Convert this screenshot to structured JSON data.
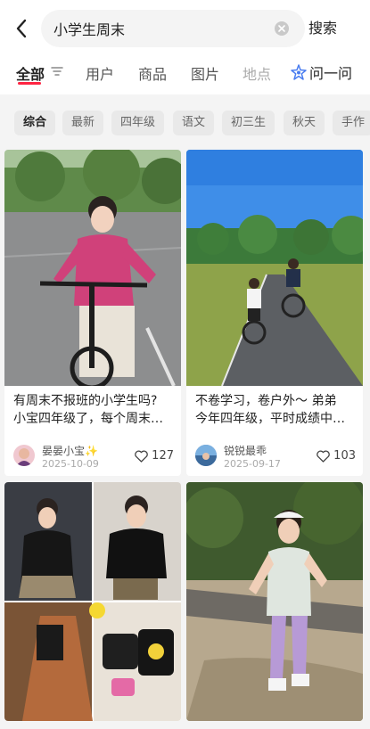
{
  "search": {
    "query": "小学生周末",
    "button_label": "搜索"
  },
  "tabs": [
    {
      "label": "全部"
    },
    {
      "label": "用户"
    },
    {
      "label": "商品"
    },
    {
      "label": "图片"
    },
    {
      "label": "地点"
    }
  ],
  "ask": {
    "label": "问一问"
  },
  "chips": [
    "综合",
    "最新",
    "四年级",
    "语文",
    "初三生",
    "秋天",
    "手作"
  ],
  "cards": [
    {
      "title_line1": "有周末不报班的小学生吗?",
      "title_line2": "小宝四年级了，每个周末…",
      "author": "晏晏小宝✨",
      "date": "2025-10-09",
      "likes": "127"
    },
    {
      "title_line1": "不卷学习，卷户外～ 弟弟",
      "title_line2": "今年四年级，平时成绩中…",
      "author": "锐锐最乖",
      "date": "2025-09-17",
      "likes": "103"
    }
  ],
  "colors": {
    "accent": "#ff2442",
    "page_bg": "#f4f4f4",
    "ask_icon": "#4a7df0"
  }
}
